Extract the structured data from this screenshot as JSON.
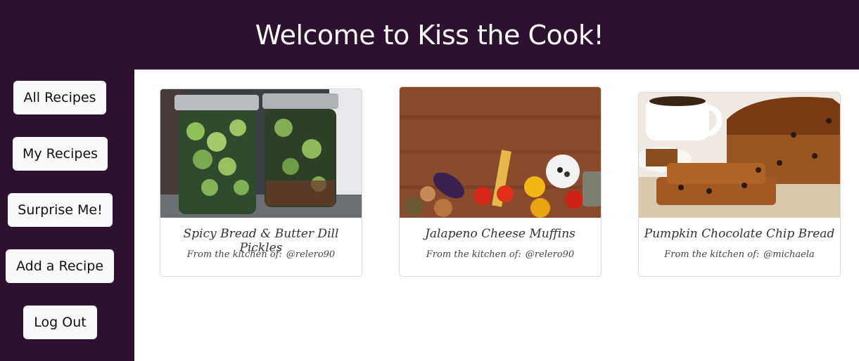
{
  "header": {
    "title": "Welcome to Kiss the Cook!"
  },
  "sidebar": {
    "items": [
      {
        "label": "All Recipes"
      },
      {
        "label": "My Recipes"
      },
      {
        "label": "Surprise Me!"
      },
      {
        "label": "Add a Recipe"
      },
      {
        "label": "Log Out"
      }
    ]
  },
  "recipes": [
    {
      "title": "Spicy Bread & Butter Dill Pickles",
      "author_prefix": "From the kitchen of:",
      "author": "@relero90"
    },
    {
      "title": "Jalapeno Cheese Muffins",
      "author_prefix": "From the kitchen of:",
      "author": "@relero90"
    },
    {
      "title": "Pumpkin Chocolate Chip Bread",
      "author_prefix": "From the kitchen of:",
      "author": "@michaela"
    }
  ],
  "colors": {
    "brand": "#2d1230",
    "button": "#f8f9fa",
    "card_border": "#d9d9d9"
  }
}
